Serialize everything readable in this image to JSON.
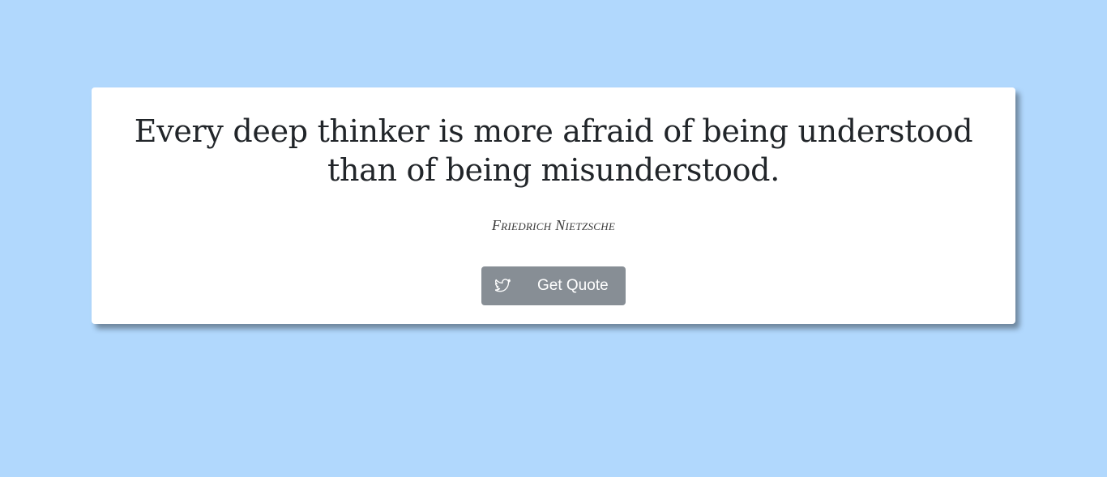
{
  "page": {
    "background_color": "#b1d8fd"
  },
  "quote": {
    "text": "Every deep thinker is more afraid of being understood than of being misunderstood.",
    "author": "Friedrich Nietzsche"
  },
  "actions": {
    "tweet_icon": "twitter-icon",
    "get_quote_label": "Get Quote",
    "button_color": "#878e95"
  }
}
